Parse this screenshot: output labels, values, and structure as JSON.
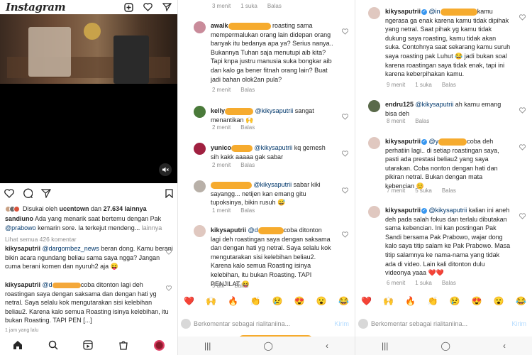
{
  "panel1": {
    "logo": "Instagram",
    "likes_text_pre": "Disukai oleh ",
    "likes_user": "ucentown",
    "likes_text_mid": " dan ",
    "likes_count": "27.634 lainnya",
    "caption_user": "sandiuno",
    "caption_text": " Ada yang menarik saat bertemu dengan Pak ",
    "caption_mention": "@prabowo",
    "caption_text2": " kemarin sore. Ia terkejut mendeng...",
    "caption_more": " lainnya",
    "view_all": "Lihat semua 426 komentar",
    "c1_user": "kikysaputrii",
    "c1_mention": " @dargombez_news",
    "c1_text": " beran dong. Kamu berani bikin acara ngundang beliau sama saya ngga? Jangan cuma berani komen dan nyuruh2 aja 😝",
    "c2_user": "kikysaputrii",
    "c2_mention": " @d",
    "c2_text": "coba ditonton lagi deh roastingan saya dengan saksama dan dengan hati yg netral. Saya selalu kok mengutarakan sisi kelebihan beliau2. Karena kalo semua Roasting isinya kelebihan, itu bukan Roasting. TAPI PEN [...]",
    "timestamp": "1 jam yang lalu"
  },
  "panel2": {
    "top_meta": [
      "3 menit",
      "1 suka",
      "Balas"
    ],
    "comments": [
      {
        "user": "awalk",
        "mention": "",
        "text": " roasting sama mempermalukan orang lain didepan orang banyak itu bedanya apa ya? Serius nanya.. Bukannya Tuhan saja menutupi aib kita? Tapi knpa justru manusia suka bongkar aib dan kalo ga bener fitnah orang lain? Buat jadi bahan olok2an pula?",
        "time": "2 menit",
        "reply": "Balas",
        "likes": ""
      },
      {
        "user": "kelly",
        "mention": "@kikysaputrii",
        "text": " sangat menantikan 🙌",
        "time": "2 menit",
        "reply": "Balas",
        "likes": ""
      },
      {
        "user": "yunico",
        "mention": "@kikysaputrii",
        "text": " kq gemesh sih kakk aaaaa gak sabar",
        "time": "2 menit",
        "reply": "Balas",
        "likes": ""
      },
      {
        "user": "",
        "mention": "@kikysaputrii",
        "text": " sabar kiki sayangg... netijen kan emang gitu tupoksinya, bikin rusuh 😅",
        "time": "1 menit",
        "reply": "Balas",
        "likes": ""
      },
      {
        "user": "kikysaputrii",
        "mention": "@d",
        "text": "coba ditonton lagi deh roastingan saya dengan saksama dan dengan hati yg netral. Saya selalu kok mengutarakan sisi kelebihan beliau2. Karena kalo semua Roasting isinya kelebihan, itu bukan Roasting. TAPI PENJILAT 😝",
        "time": "9 dtk",
        "reply": "Balas",
        "likes": ""
      }
    ],
    "emojis": [
      "❤️",
      "🙌",
      "🔥",
      "👏",
      "😢",
      "😍",
      "😮",
      "😂"
    ],
    "compose_placeholder": "Berkomentar sebagai rialitaniina...",
    "send": "Kirim"
  },
  "panel3": {
    "comments": [
      {
        "user": "kikysaputrii",
        "mention": "@in",
        "text": "kamu ngerasa ga enak karena kamu tidak dipihak yang netral. Saat pihak yg kamu tidak dukung saya roasting, kamu tidak akan suka. Contohnya saat sekarang kamu suruh saya roasting pak Luhut 😂 jadi bukan soal karena roastingan saya tidak enak, tapi ini karena keberpihakan kamu.",
        "time": "9 menit",
        "likes": "1 suka",
        "reply": "Balas"
      },
      {
        "user": "endru125",
        "mention": "@kikysaputrii",
        "text": " ah kamu emang bisa deh",
        "time": "8 menit",
        "likes": "",
        "reply": "Balas"
      },
      {
        "user": "kikysaputrii",
        "mention": "@y",
        "text": "coba deh perhatiin lagi.. di setiap roastingan saya, pasti ada prestasi beliau2 yang saya utarakan. Coba nonton dengan hati dan pikiran netral. Bukan dengan mata kebencian 😊",
        "time": "7 menit",
        "likes": "5 suka",
        "reply": "Balas"
      },
      {
        "user": "kikysaputrii",
        "mention": "@kikysaputrii",
        "text": " kalian ini aneh deh pada salah fokus dan terlalu dibutakan sama kebencian. Ini kan postingan Pak Sandi bersama Pak Prabowo, wajar dong kalo saya titip salam ke Pak Prabowo. Masa titip salamnya ke nama-nama yang tidak ada di video. Lain kali ditonton dulu videonya yaaa ❤️❤️",
        "time": "6 menit",
        "likes": "1 suka",
        "reply": "Balas"
      }
    ],
    "emojis": [
      "❤️",
      "🙌",
      "🔥",
      "👏",
      "😢",
      "😍",
      "😮",
      "😂"
    ],
    "compose_placeholder": "Berkomentar sebagai rialitaniina...",
    "send": "Kirim"
  },
  "colors": {
    "accent": "#3897f0",
    "mention": "#00376b",
    "highlight": "#f5a623"
  }
}
